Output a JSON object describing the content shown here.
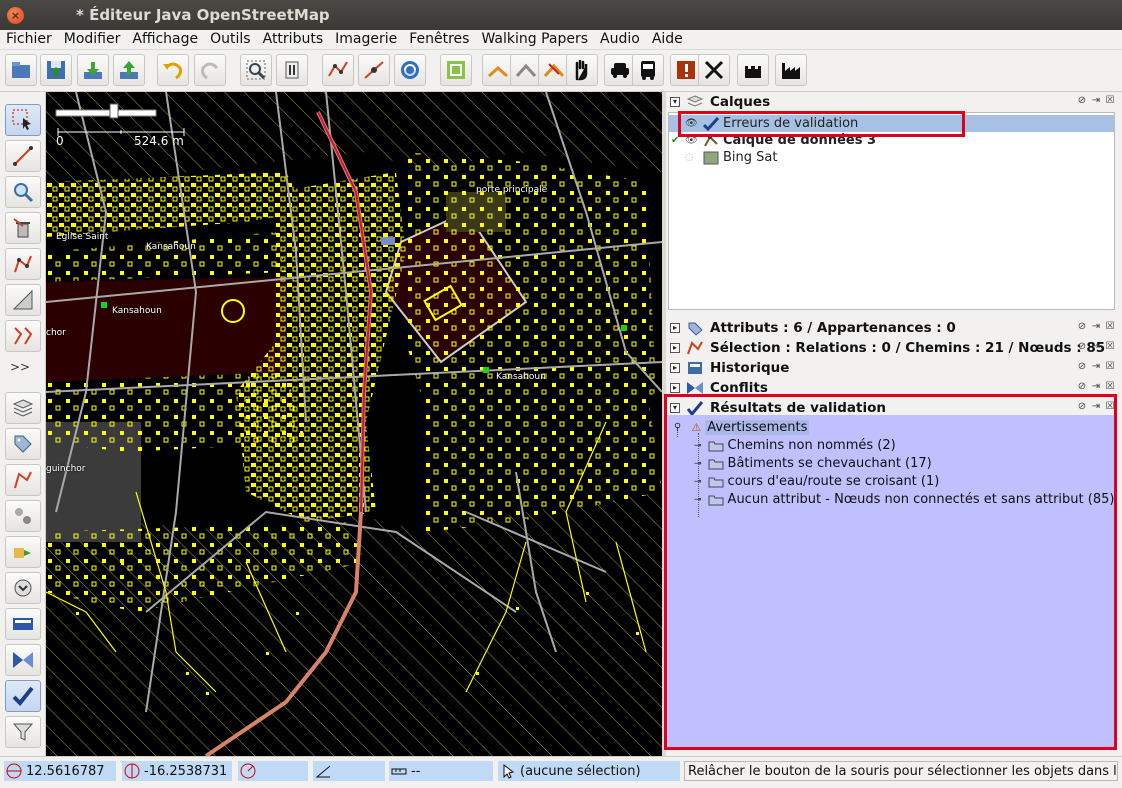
{
  "window": {
    "title": "* Éditeur Java OpenStreetMap"
  },
  "menu": [
    "Fichier",
    "Modifier",
    "Affichage",
    "Outils",
    "Attributs",
    "Imagerie",
    "Fenêtres",
    "Walking Papers",
    "Audio",
    "Aide"
  ],
  "toolbar": {
    "icons": [
      "open-icon",
      "save-icon",
      "download-icon",
      "upload-icon",
      "undo-icon",
      "redo-icon",
      "zoom-to-icon",
      "preferences-icon",
      "split-way-icon",
      "merge-nodes-icon",
      "sync-icon",
      "orthogonalize-icon",
      "align-line-icon",
      "align-circle-icon",
      "unglue-icon",
      "move-hand-icon",
      "car-preset-icon",
      "bus-preset-icon",
      "validate-warning-icon",
      "tools-icon",
      "castle-icon",
      "industry-icon"
    ]
  },
  "left_tools": {
    "more_label": ">>"
  },
  "map": {
    "scale_start": "0",
    "scale_end": "524.6 m",
    "labels": [
      "Kansahoun",
      "Eglise Saint",
      "porte principale",
      "Kansahoun",
      "Kansahoun",
      "chor",
      "guinchor"
    ]
  },
  "layers_panel": {
    "title": "Calques",
    "items": [
      {
        "name": "Erreurs de validation",
        "visible": true,
        "selected": true
      },
      {
        "name": "Calque de données 3",
        "visible": true,
        "selected": false,
        "active": true
      },
      {
        "name": "Bing Sat",
        "visible": false,
        "selected": false
      }
    ]
  },
  "panels": {
    "attributes": "Attributs : 6 / Appartenances : 0",
    "selection": "Sélection : Relations : 0 / Chemins : 21 / Nœuds : 85",
    "history": "Historique",
    "conflicts": "Conflits"
  },
  "validation_panel": {
    "title": "Résultats de validation",
    "root": "Avertissements",
    "items": [
      "Chemins non nommés (2)",
      "Bâtiments se chevauchant (17)",
      "cours d'eau/route se croisant (1)",
      "Aucun attribut - Nœuds non connectés et sans attribut (85)"
    ]
  },
  "status": {
    "latitude": "12.5616787",
    "longitude": "-16.2538731",
    "heading": "",
    "angle": "",
    "distance": "--",
    "selection": "(aucune sélection)",
    "help": "Relâcher le bouton de la souris pour sélectionner les objets dans le"
  },
  "colors": {
    "highlight": "#e0001b",
    "validation_bg": "#c0c0ff",
    "selected_row": "#a8c0e4",
    "map_feature": "#ffff00"
  }
}
